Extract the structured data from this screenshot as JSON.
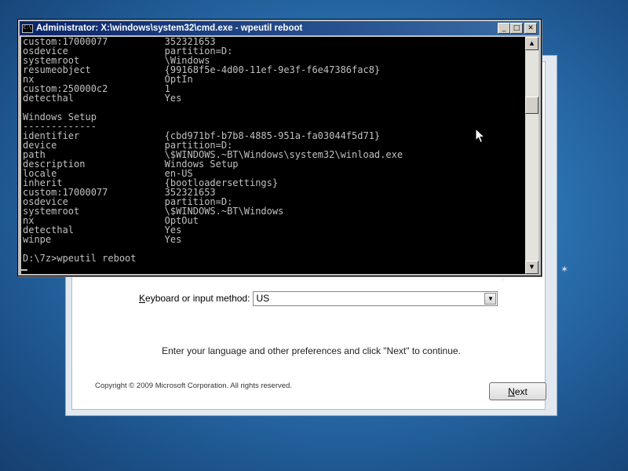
{
  "cmd": {
    "title": "Administrator: X:\\windows\\system32\\cmd.exe - wpeutil  reboot",
    "icon_text": "C:\\",
    "controls": {
      "minimize": "_",
      "maximize": "□",
      "close": "✕"
    },
    "lines": [
      "custom:17000077          352321653",
      "osdevice                 partition=D:",
      "systemroot               \\Windows",
      "resumeobject             {99168f5e-4d00-11ef-9e3f-f6e47386fac8}",
      "nx                       OptIn",
      "custom:250000c2          1",
      "detecthal                Yes",
      "",
      "Windows Setup",
      "-------------",
      "identifier               {cbd971bf-b7b8-4885-951a-fa03044f5d71}",
      "device                   partition=D:",
      "path                     \\$WINDOWS.~BT\\Windows\\system32\\winload.exe",
      "description              Windows Setup",
      "locale                   en-US",
      "inherit                  {bootloadersettings}",
      "custom:17000077          352321653",
      "osdevice                 partition=D:",
      "systemroot               \\$WINDOWS.~BT\\Windows",
      "nx                       OptOut",
      "detecthal                Yes",
      "winpe                    Yes",
      "",
      "D:\\7z>wpeutil reboot"
    ],
    "scrollbar": {
      "up": "▲",
      "down": "▼"
    }
  },
  "setup": {
    "keyboard_label_accel": "K",
    "keyboard_label_rest": "eyboard or input method:",
    "keyboard_value": "US",
    "dropdown_arrow": "▼",
    "instruction": "Enter your language and other preferences and click \"Next\" to continue.",
    "copyright": "Copyright © 2009 Microsoft Corporation. All rights reserved.",
    "next_accel": "N",
    "next_rest": "ext"
  },
  "colors": {
    "desktop": "#2a6fae",
    "console_bg": "#000000",
    "console_fg": "#c0c0c0",
    "titlebar": "#0a246a"
  }
}
